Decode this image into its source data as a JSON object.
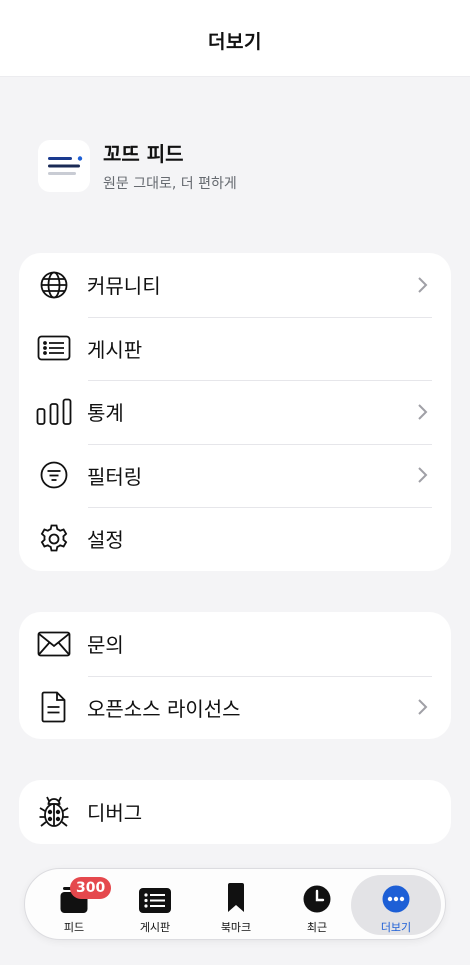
{
  "header": {
    "title": "더보기"
  },
  "app": {
    "name": "꼬뜨 피드",
    "tagline": "원문 그대로, 더 편하게"
  },
  "menu_main": [
    {
      "label": "커뮤니티",
      "icon": "globe-icon",
      "chevron": true
    },
    {
      "label": "게시판",
      "icon": "list-icon",
      "chevron": false
    },
    {
      "label": "통계",
      "icon": "bar-chart-icon",
      "chevron": true
    },
    {
      "label": "필터링",
      "icon": "filter-icon",
      "chevron": true
    },
    {
      "label": "설정",
      "icon": "gear-icon",
      "chevron": false
    }
  ],
  "menu_support": [
    {
      "label": "문의",
      "icon": "mail-icon",
      "chevron": false
    },
    {
      "label": "오픈소스 라이선스",
      "icon": "document-icon",
      "chevron": true
    }
  ],
  "menu_debug": [
    {
      "label": "디버그",
      "icon": "bug-icon",
      "chevron": false
    }
  ],
  "tabs": [
    {
      "label": "피드",
      "icon": "feed-icon",
      "badge": "300",
      "active": false
    },
    {
      "label": "게시판",
      "icon": "list-icon",
      "active": false
    },
    {
      "label": "북마크",
      "icon": "bookmark-icon",
      "active": false
    },
    {
      "label": "최근",
      "icon": "clock-icon",
      "active": false
    },
    {
      "label": "더보기",
      "icon": "more-icon",
      "active": true
    }
  ],
  "colors": {
    "accent": "#1d5fd6",
    "badge": "#e5484d",
    "background": "#f4f4f6"
  }
}
